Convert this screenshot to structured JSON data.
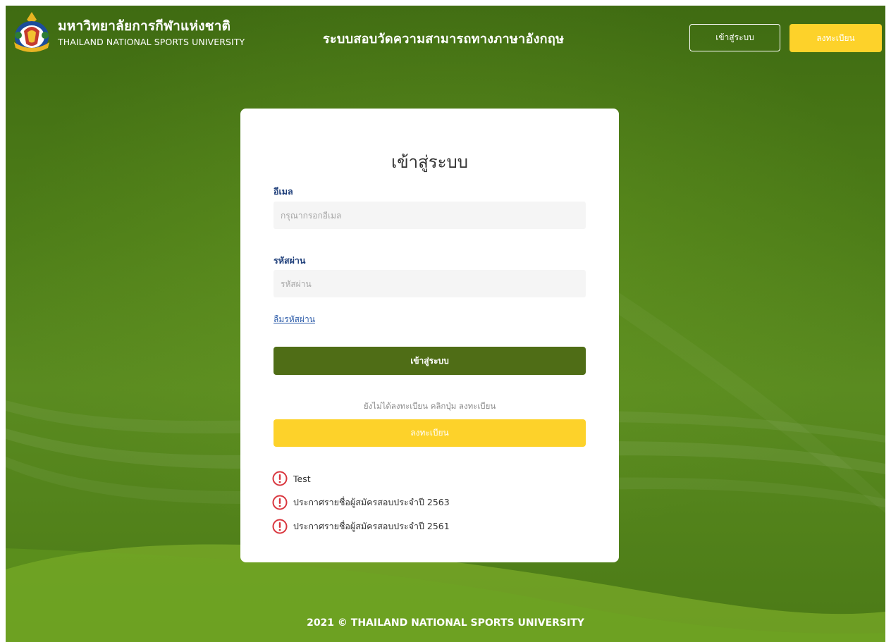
{
  "header": {
    "brand_th": "มหาวิทยาลัยการกีฬาแห่งชาติ",
    "brand_en": "THAILAND NATIONAL SPORTS UNIVERSITY",
    "site_title": "ระบบสอบวัดความสามารถทางภาษาอังกฤษ",
    "login_label": "เข้าสู่ระบบ",
    "register_label": "ลงทะเบียน"
  },
  "login_card": {
    "title": "เข้าสู่ระบบ",
    "email_label": "อีเมล",
    "email_placeholder": "กรุณากรอกอีเมล",
    "email_value": "",
    "password_label": "รหัสผ่าน",
    "password_placeholder": "รหัสผ่าน",
    "password_value": "",
    "forgot_password": "ลืมรหัสผ่าน",
    "submit_label": "เข้าสู่ระบบ",
    "register_hint": "ยังไม่ได้ลงทะเบียน คลิกปุ่ม ลงทะเบียน",
    "register_label": "ลงทะเบียน"
  },
  "announcements": [
    {
      "icon": "exclamation-circle-icon",
      "text": "Test"
    },
    {
      "icon": "exclamation-circle-icon",
      "text": "ประกาศรายชื่อผู้สมัครสอบประจำปี 2563"
    },
    {
      "icon": "exclamation-circle-icon",
      "text": "ประกาศรายชื่อผู้สมัครสอบประจำปี 2561"
    }
  ],
  "footer": {
    "copyright": "2021 © THAILAND NATIONAL SPORTS UNIVERSITY"
  },
  "colors": {
    "background_green": "#4d7d18",
    "primary_button": "#4f6d16",
    "accent_yellow": "#fdd22a",
    "alert_red": "#d9363e",
    "label_blue": "#1f3f7a"
  }
}
